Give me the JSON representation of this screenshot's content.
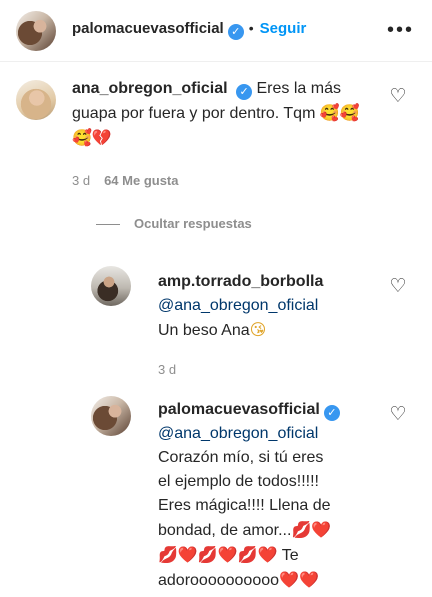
{
  "header": {
    "username": "palomacuevasofficial",
    "separator": "•",
    "follow_label": "Seguir",
    "more_icon": "•••"
  },
  "comment": {
    "username": "ana_obregon_oficial",
    "text": "Eres la más guapa por fuera y por dentro. Tqm",
    "emojis": "🥰🥰🥰💔",
    "time": "3 d",
    "likes": "64 Me gusta"
  },
  "replies_toggle": "Ocultar respuestas",
  "replies": [
    {
      "username": "amp.torrado_borbolla",
      "mention": "@ana_obregon_oficial",
      "text": "Un beso Ana",
      "emoji": "😘",
      "time": "3 d"
    },
    {
      "username": "palomacuevasofficial",
      "mention": "@ana_obregon_oficial",
      "lines": [
        "Corazón mío, si tú eres",
        "el ejemplo de todos!!!!!",
        "Eres mágica!!!! Llena de",
        "bondad, de amor..."
      ],
      "line5_text": "Te",
      "line6_text": "adoroooooooooo",
      "hearts_a": "💋❤️",
      "hearts_b": "💋❤️💋❤️💋❤️",
      "hearts_c": "❤️❤️"
    }
  ],
  "icons": {
    "heart": "♡",
    "verified": "✓"
  }
}
